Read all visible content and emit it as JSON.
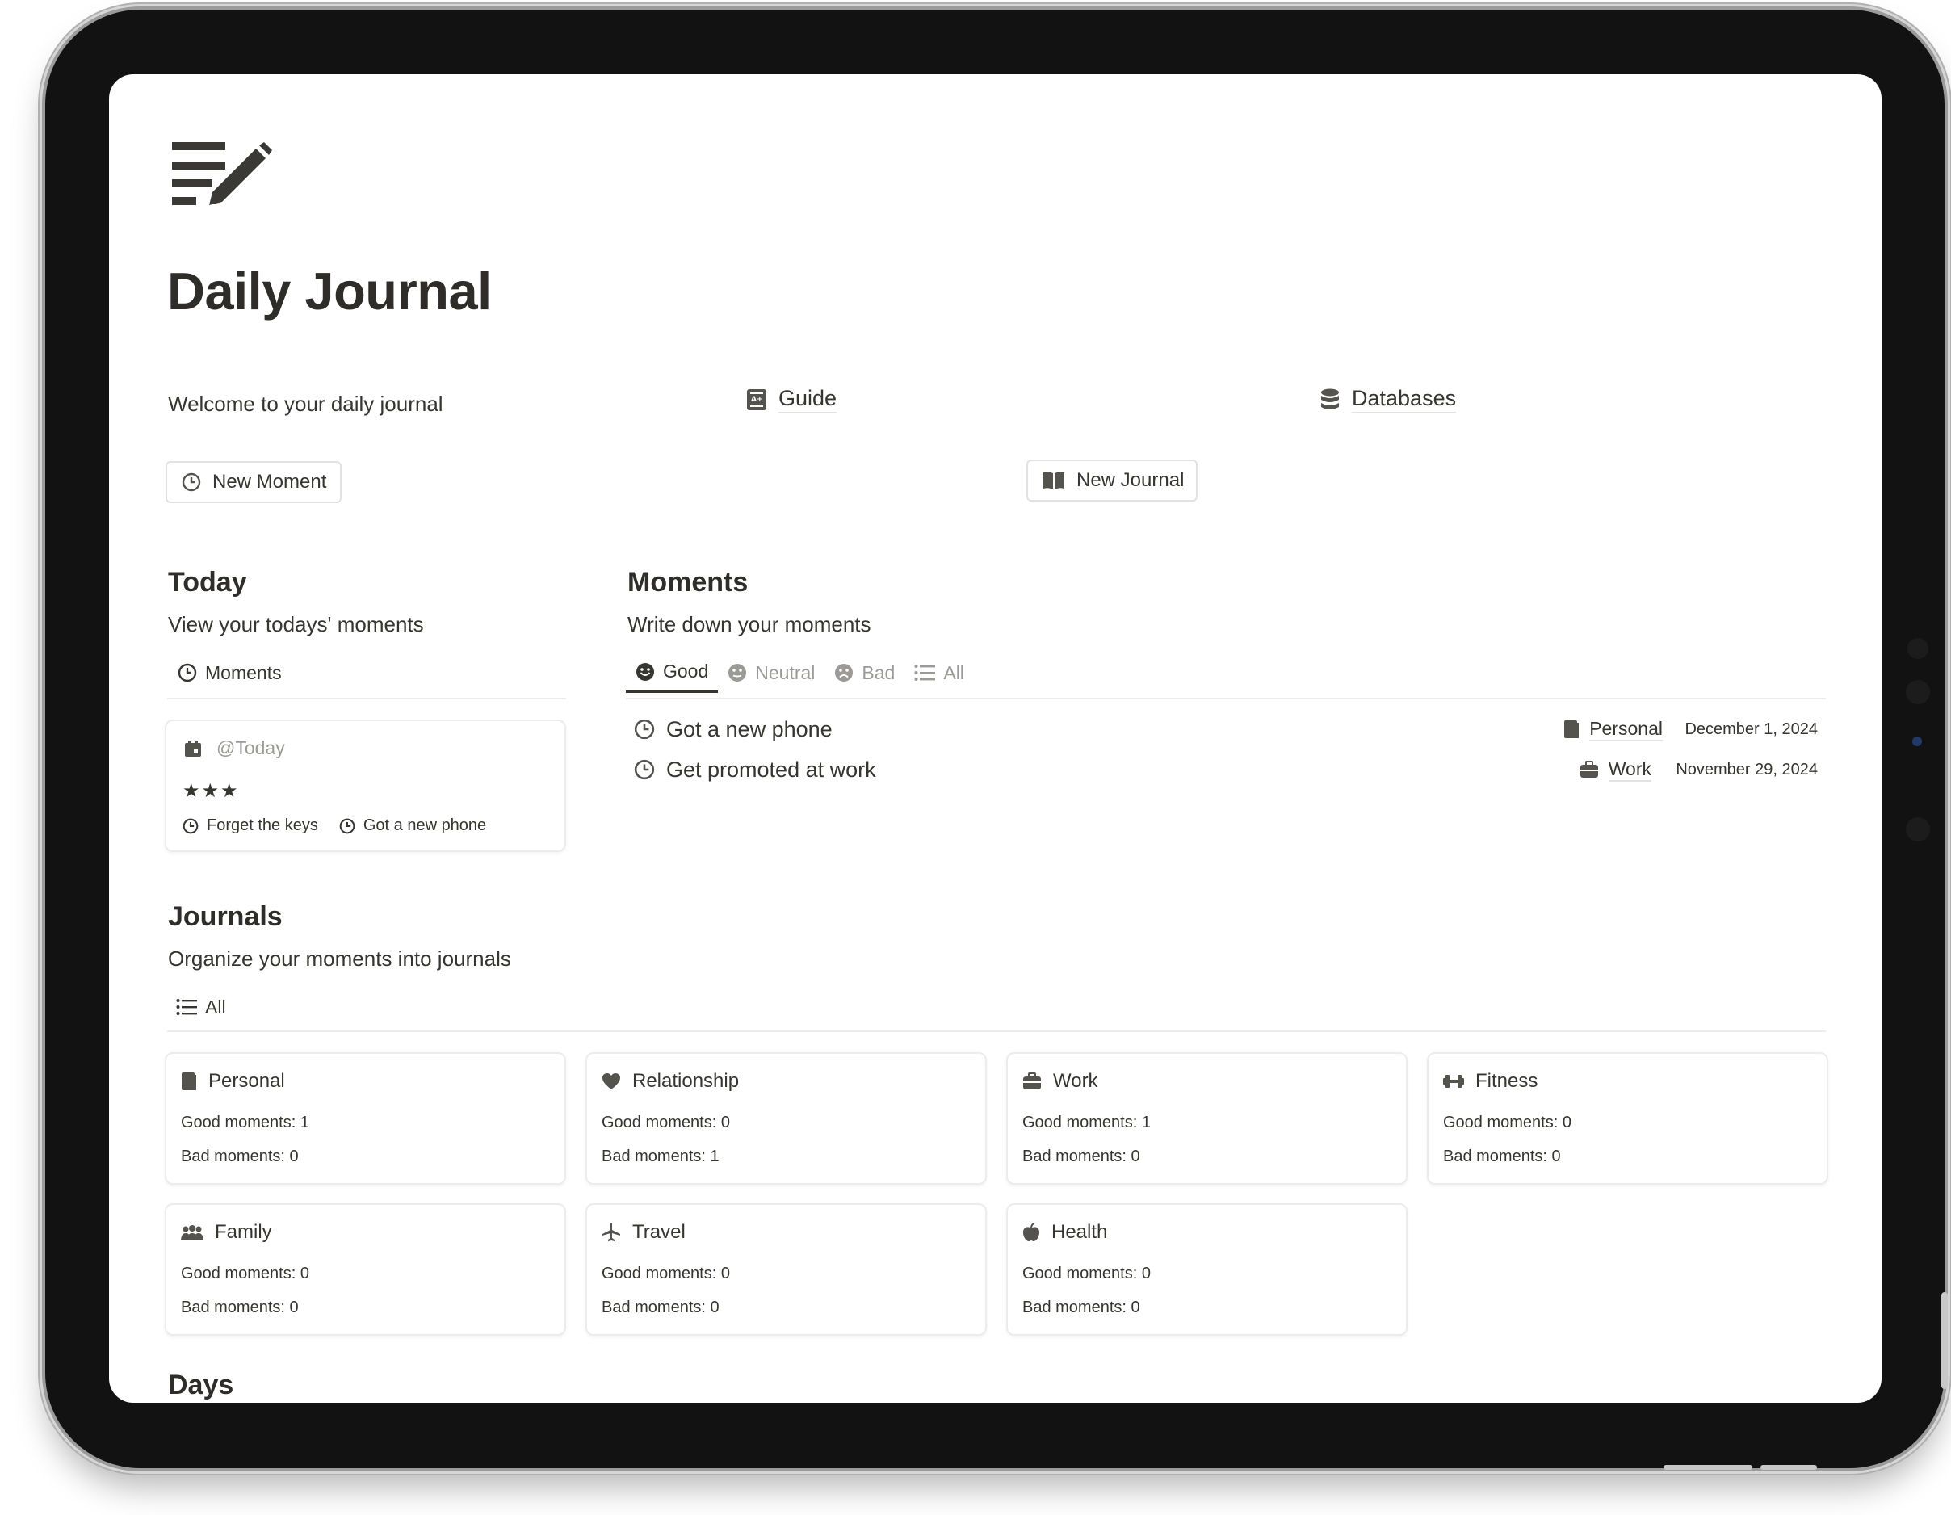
{
  "page": {
    "title": "Daily Journal",
    "welcome": "Welcome to your daily journal",
    "links": [
      {
        "label": "Guide",
        "icon": "guide-book-icon"
      },
      {
        "label": "Databases",
        "icon": "database-icon"
      }
    ],
    "buttons": {
      "new_moment": "New Moment",
      "new_journal": "New Journal"
    }
  },
  "today": {
    "heading": "Today",
    "description": "View your todays' moments",
    "tab": "Moments",
    "card": {
      "date": "@Today",
      "rating": "★★★",
      "moments": [
        "Forget the keys",
        "Got a new phone"
      ]
    }
  },
  "moments": {
    "heading": "Moments",
    "description": "Write down your moments",
    "tabs": [
      {
        "label": "Good",
        "icon": "smile-icon",
        "active": true
      },
      {
        "label": "Neutral",
        "icon": "neutral-face-icon",
        "active": false
      },
      {
        "label": "Bad",
        "icon": "frown-icon",
        "active": false
      },
      {
        "label": "All",
        "icon": "list-icon",
        "active": false
      }
    ],
    "rows": [
      {
        "title": "Got a new phone",
        "journal": "Personal",
        "journal_icon": "book-icon",
        "date": "December 1, 2024"
      },
      {
        "title": "Get promoted at work",
        "journal": "Work",
        "journal_icon": "briefcase-icon",
        "date": "November 29, 2024"
      }
    ]
  },
  "journals": {
    "heading": "Journals",
    "description": "Organize your moments into journals",
    "tab": "All",
    "cards": [
      {
        "name": "Personal",
        "icon": "book-icon",
        "good": "Good moments: 1",
        "bad": "Bad moments: 0"
      },
      {
        "name": "Relationship",
        "icon": "heart-icon",
        "good": "Good moments: 0",
        "bad": "Bad moments: 1"
      },
      {
        "name": "Work",
        "icon": "briefcase-icon",
        "good": "Good moments: 1",
        "bad": "Bad moments: 0"
      },
      {
        "name": "Fitness",
        "icon": "dumbbell-icon",
        "good": "Good moments: 0",
        "bad": "Bad moments: 0"
      },
      {
        "name": "Family",
        "icon": "people-icon",
        "good": "Good moments: 0",
        "bad": "Bad moments: 0"
      },
      {
        "name": "Travel",
        "icon": "airplane-icon",
        "good": "Good moments: 0",
        "bad": "Bad moments: 0"
      },
      {
        "name": "Health",
        "icon": "apple-icon",
        "good": "Good moments: 0",
        "bad": "Bad moments: 0"
      }
    ]
  },
  "days": {
    "heading": "Days"
  },
  "colors": {
    "text": "#37352f",
    "muted": "#9b9a97",
    "border": "#e3e2e0",
    "device": "#121212"
  }
}
